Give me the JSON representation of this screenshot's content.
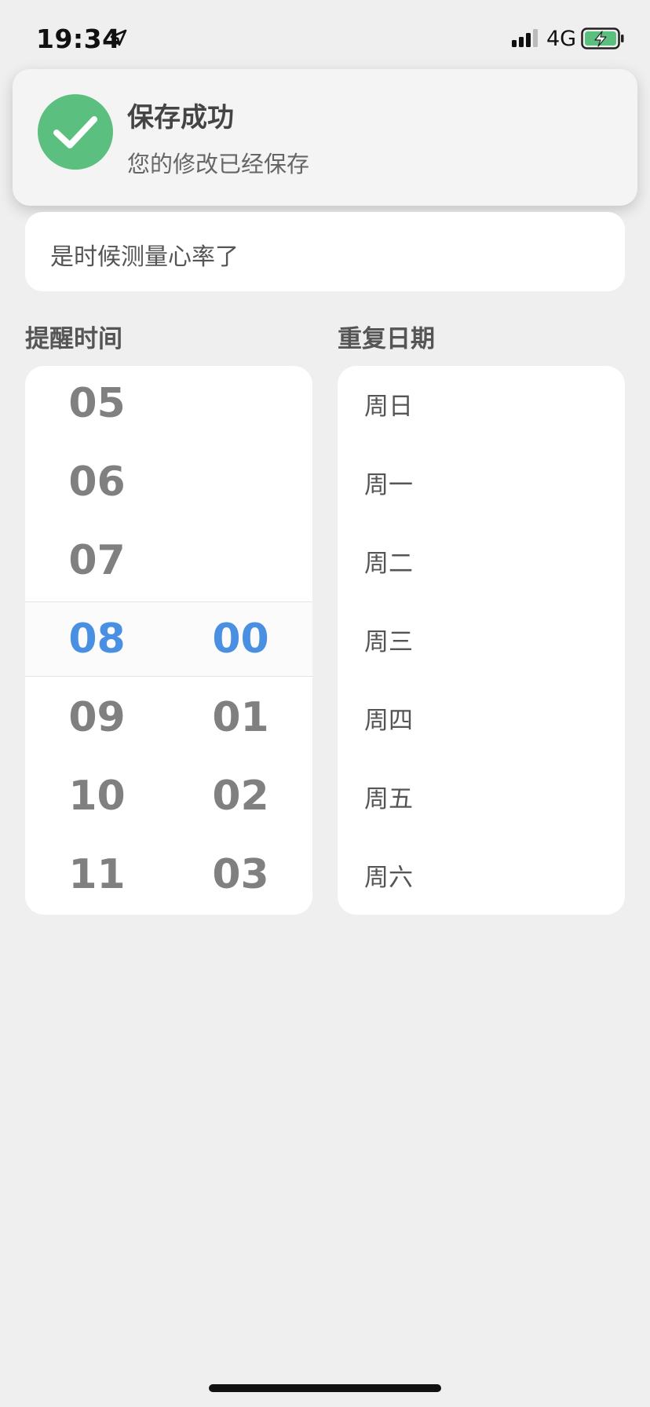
{
  "status_bar": {
    "time": "19:34",
    "network": "4G",
    "icons": [
      "location-arrow-icon",
      "signal-icon",
      "battery-charging-icon"
    ]
  },
  "toast": {
    "title": "保存成功",
    "subtitle": "您的修改已经保存",
    "icon": "check-circle-icon",
    "icon_color": "#5bbf7f"
  },
  "message": {
    "text": "是时候测量心率了"
  },
  "reminder_time": {
    "title": "提醒时间",
    "hours": [
      "05",
      "06",
      "07",
      "08",
      "09",
      "10",
      "11"
    ],
    "minutes": [
      "00",
      "01",
      "02",
      "03"
    ],
    "selected_hour": "08",
    "selected_minute": "00",
    "selected_color": "#4a90e2"
  },
  "repeat_days": {
    "title": "重复日期",
    "days": [
      "周日",
      "周一",
      "周二",
      "周三",
      "周四",
      "周五",
      "周六"
    ]
  }
}
